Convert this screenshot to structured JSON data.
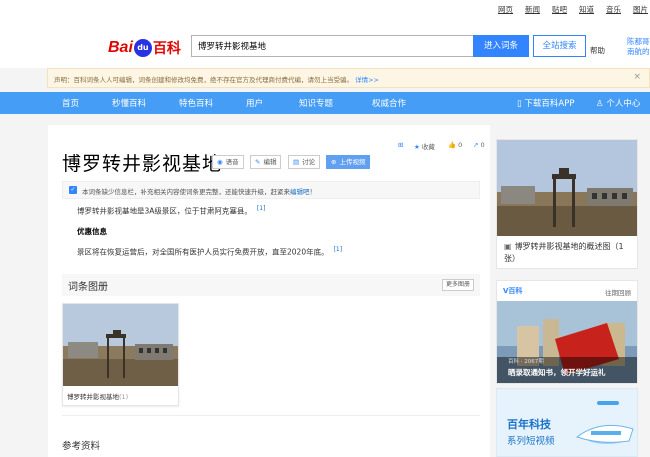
{
  "top_links": [
    "网页",
    "新闻",
    "贴吧",
    "知道",
    "音乐",
    "图片"
  ],
  "logo": {
    "bai": "Bai",
    "du": "du",
    "baike": "百科"
  },
  "search": {
    "value": "博罗转井影视基地",
    "enter_label": "进入词条",
    "site_label": "全站搜索",
    "help_label": "帮助"
  },
  "user": {
    "line1": "陈都哥",
    "line2": "南航的"
  },
  "notice": {
    "text": "声明：百科词条人人可编辑，词条创建和修改均免费，绝不存在官方及代理商付费代编，请勿上当受骗。",
    "more": "详情>>",
    "close": "×"
  },
  "navbar": {
    "items": [
      "首页",
      "秒懂百科",
      "特色百科",
      "用户",
      "知识专题",
      "权威合作"
    ],
    "app_label": "下载百科APP",
    "center_label": "个人中心"
  },
  "article": {
    "title": "博罗转井影视基地",
    "buttons": {
      "voice": "语音",
      "edit": "编辑",
      "discuss": "讨论",
      "upload": "上传视频"
    },
    "actions": {
      "collect": "收藏",
      "like_count": "0",
      "share_count": "0"
    },
    "lemma_note": {
      "text": "本词条缺少信息栏，补充相关内容使词条更完整，还能快速升级，赶紧来",
      "link": "编辑吧",
      "tail": "！"
    },
    "para1": "博罗转井影视基地是3A级景区，位于甘肃阿克塞县。",
    "ref1": "[1]",
    "subheading": "优惠信息",
    "para2": "景区将在恢复运营后，对全国所有医护人员实行免费开放，直至2020年底。",
    "ref2": "[1]",
    "album_title": "词条图册",
    "album_more": "更多图册",
    "album_caption": "博罗转井影视基地",
    "album_count": "(1)",
    "references_title": "参考资料"
  },
  "sidebar": {
    "pic_caption": "博罗转井影视基地的概述图（1张）",
    "video_brand": "V百科",
    "video_back": "往期回顾",
    "video_sub": "百科 · 2067期",
    "video_title": "晒录取通知书，领开学好运礼",
    "banner_line1": "百年科技",
    "banner_line2": "系列短视频"
  }
}
